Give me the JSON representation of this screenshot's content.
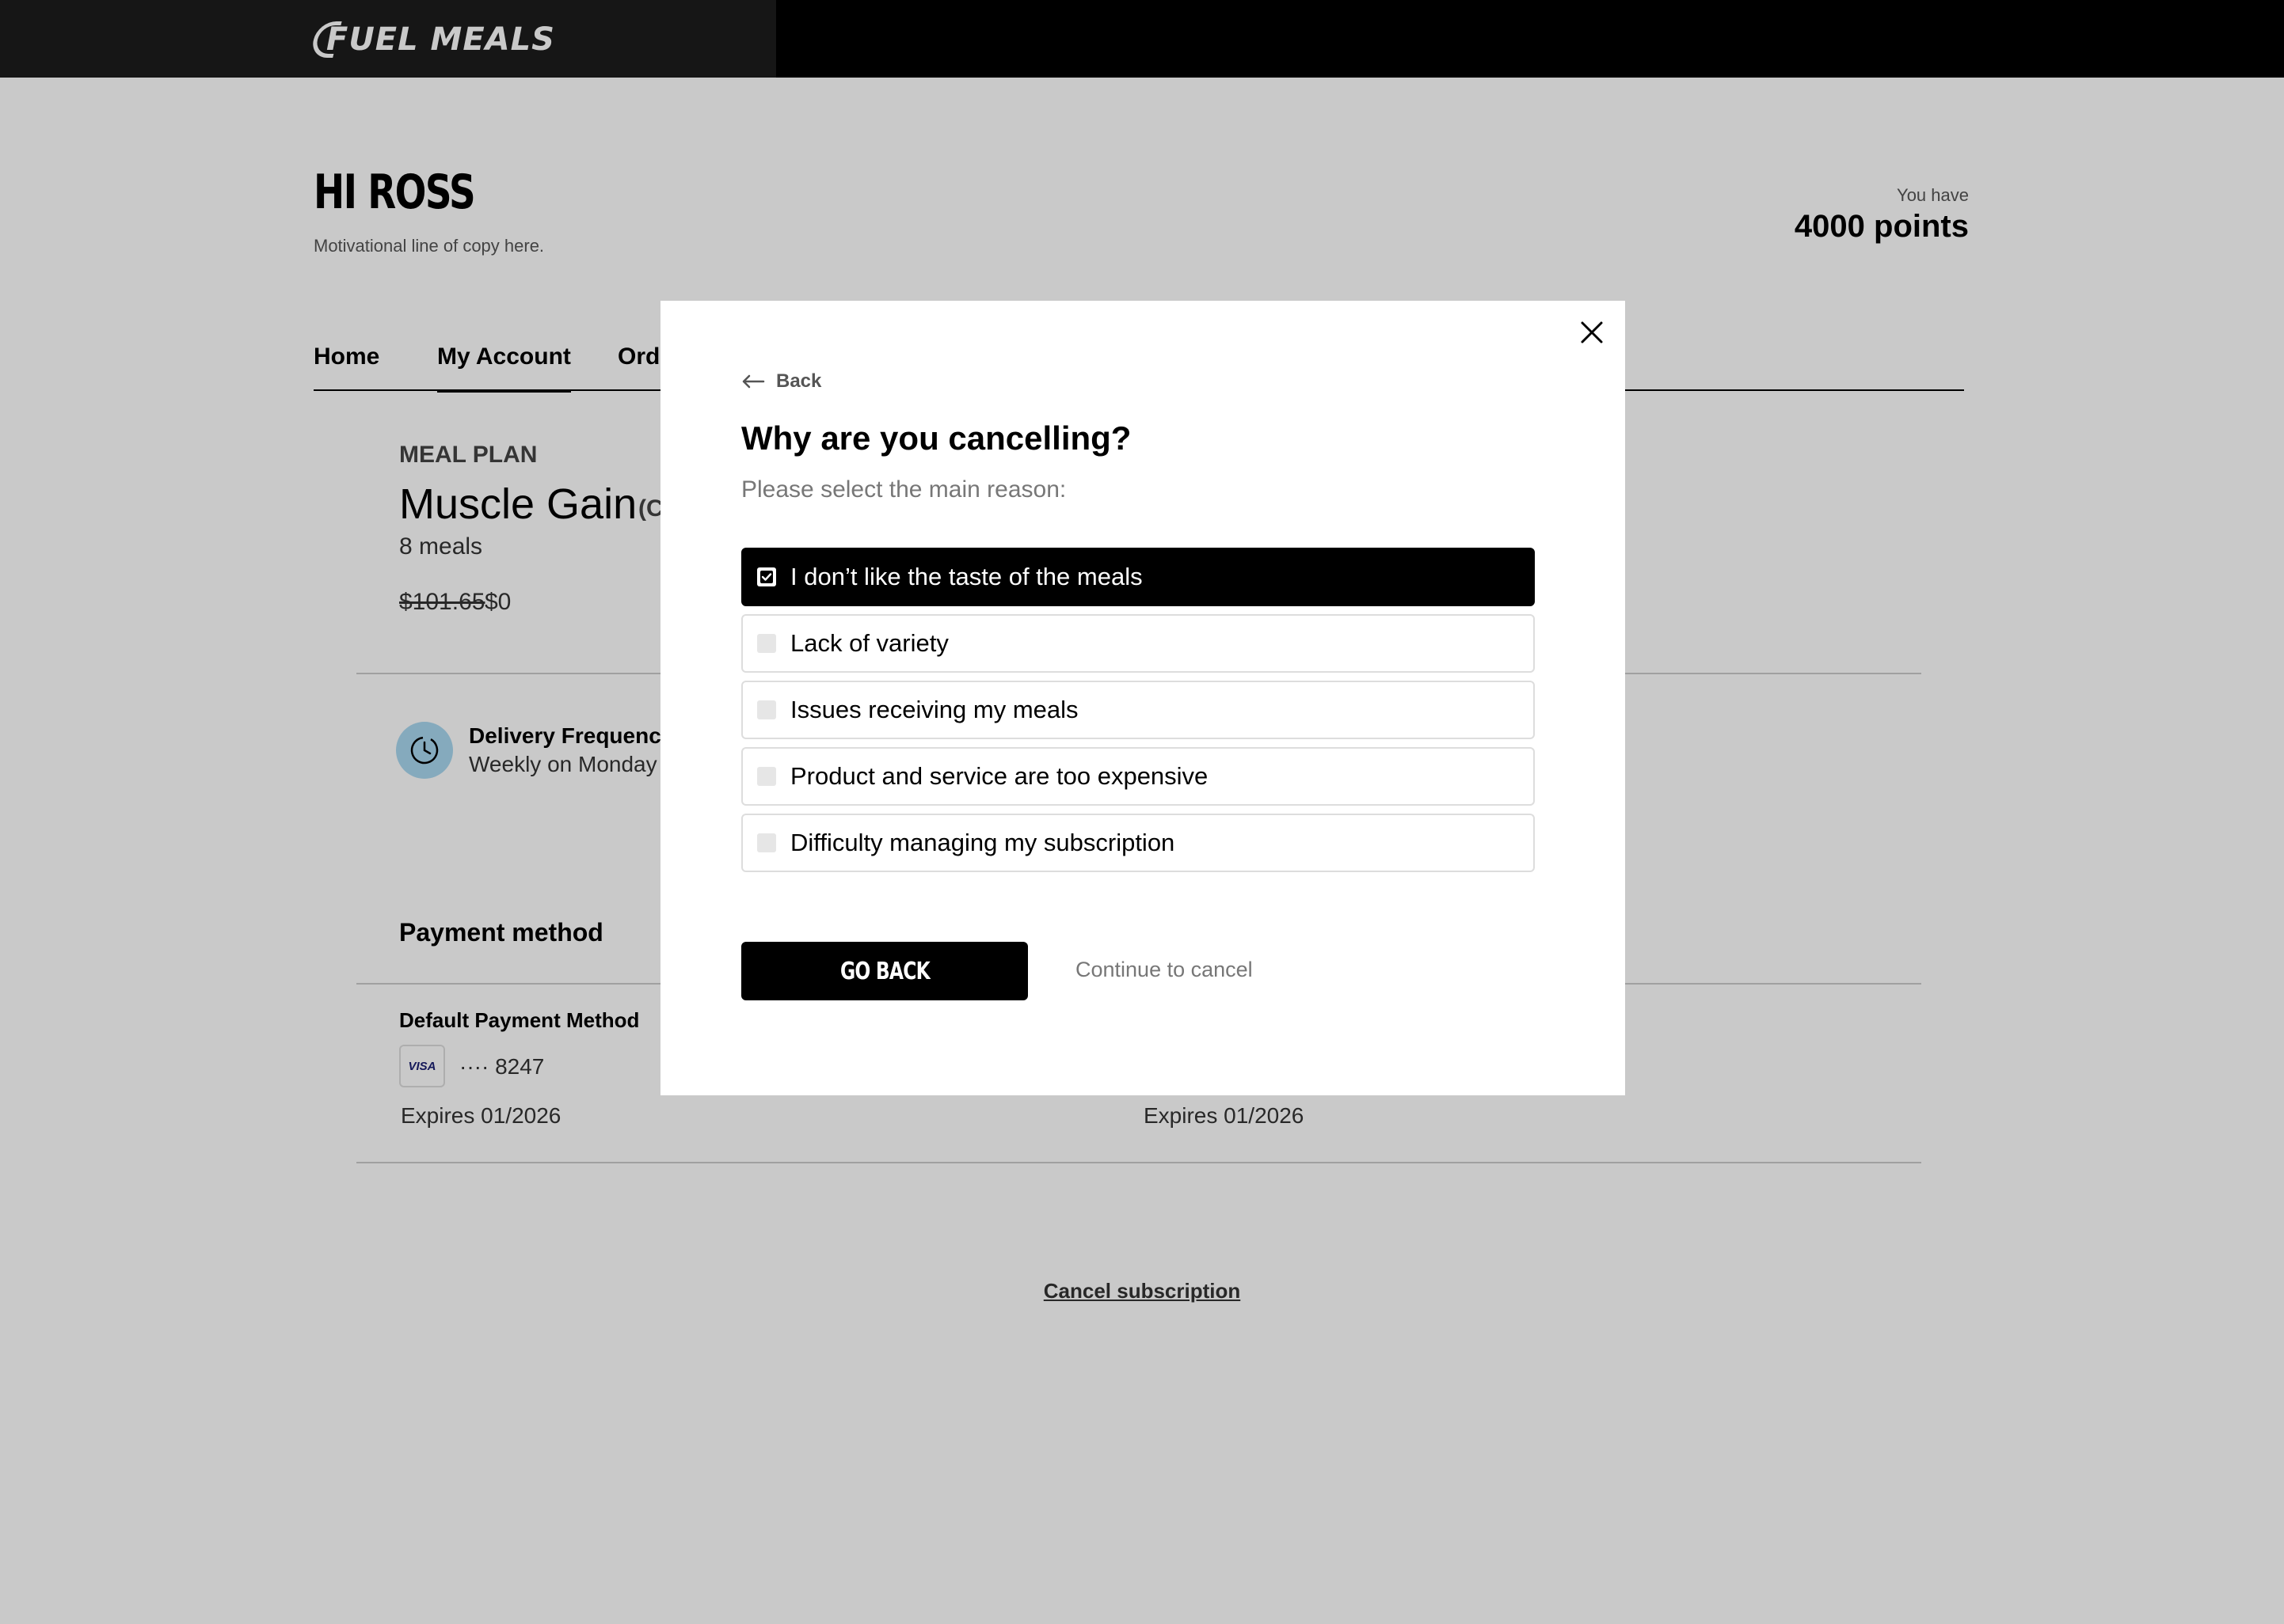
{
  "brand": {
    "name": "FUEL MEALS"
  },
  "greeting": {
    "title": "HI ROSS",
    "subtitle": "Motivational line of copy here."
  },
  "points": {
    "label": "You have",
    "value": "4000 points"
  },
  "tabs": [
    {
      "label": "Home"
    },
    {
      "label": "My Account",
      "active": true
    },
    {
      "label": "Orde"
    }
  ],
  "meal_plan": {
    "kicker": "MEAL PLAN",
    "name": "Muscle Gain",
    "sub": "(C",
    "meals": "8 meals",
    "old_price": "$101.65",
    "new_price": "$0",
    "delivery_label": "Delivery Frequency",
    "delivery_value": "Weekly on Monday"
  },
  "payment": {
    "title": "Payment method",
    "default_label": "Default Payment Method",
    "card_brand": "VISA",
    "card_last4": "···· 8247",
    "expires_1": "Expires 01/2026",
    "expires_2": "Expires 01/2026"
  },
  "cancel_link": "Cancel subscription",
  "modal": {
    "back_label": "Back",
    "title": "Why are you cancelling?",
    "subtitle": "Please select the main reason:",
    "options": [
      {
        "label": "I don’t like the taste of the meals",
        "checked": true
      },
      {
        "label": "Lack of variety",
        "checked": false
      },
      {
        "label": "Issues receiving my meals",
        "checked": false
      },
      {
        "label": "Product and service are too expensive",
        "checked": false
      },
      {
        "label": "Difficulty managing my subscription",
        "checked": false
      }
    ],
    "go_back_label": "GO BACK",
    "continue_label": "Continue to cancel"
  },
  "colors": {
    "accent": "#000000",
    "clock_bg": "#a9d8f0",
    "overlay": "rgba(0,0,0,0.21)"
  }
}
